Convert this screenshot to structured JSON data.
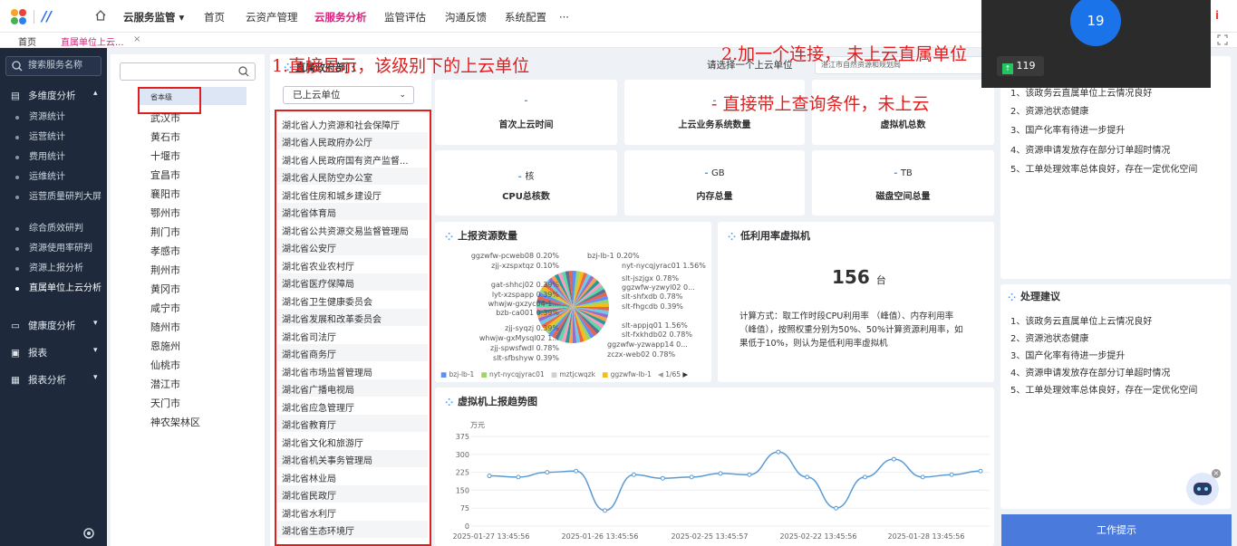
{
  "header": {
    "nav": [
      "云服务监管",
      "首页",
      "云资产管理",
      "云服务分析",
      "监管评估",
      "沟通反馈",
      "系统配置",
      "···"
    ],
    "active_nav": "云服务分析",
    "user_initial": "i"
  },
  "tabs": [
    "首页",
    "直属单位上云...",
    "×"
  ],
  "sidebar": {
    "search_placeholder": "搜索服务名称",
    "groups": [
      {
        "label": "多维度分析",
        "icon": "chart-icon"
      },
      {
        "label": "健康度分析",
        "icon": "monitor-icon"
      },
      {
        "label": "报表",
        "icon": "report-icon"
      },
      {
        "label": "报表分析",
        "icon": "report-analysis-icon"
      }
    ],
    "sub_items": [
      "资源统计",
      "运营统计",
      "费用统计",
      "运维统计",
      "运营质量研判大屏",
      "综合质效研判",
      "资源使用率研判",
      "资源上报分析",
      "直属单位上云分析"
    ]
  },
  "cities": [
    "省本级",
    "武汉市",
    "黄石市",
    "十堰市",
    "宜昌市",
    "襄阳市",
    "鄂州市",
    "荆门市",
    "孝感市",
    "荆州市",
    "黄冈市",
    "咸宁市",
    "随州市",
    "恩施州",
    "仙桃市",
    "潜江市",
    "天门市",
    "神农架林区"
  ],
  "departments": {
    "title": "直属政府部门",
    "filter": "已上云单位",
    "items": [
      "湖北省人力资源和社会保障厅",
      "湖北省人民政府办公厅",
      "湖北省人民政府国有资产监督...",
      "湖北省人民防空办公室",
      "湖北省住房和城乡建设厅",
      "湖北省体育局",
      "湖北省公共资源交易监督管理局",
      "湖北省公安厅",
      "湖北省农业农村厅",
      "湖北省医疗保障局",
      "湖北省卫生健康委员会",
      "湖北省发展和改革委员会",
      "湖北省司法厅",
      "湖北省商务厅",
      "湖北省市场监督管理局",
      "湖北省广播电视局",
      "湖北省应急管理厅",
      "湖北省教育厅",
      "湖北省文化和旅游厅",
      "湖北省机关事务管理局",
      "湖北省林业局",
      "湖北省民政厅",
      "湖北省水利厅",
      "湖北省生态环境厅"
    ]
  },
  "unit_select": {
    "label": "请选择一个上云单位",
    "value": "湛江市自然资源和规划局"
  },
  "annotations": {
    "a1": "1.直接显示，该级别下的上云单位",
    "a2": "2.加一个连接，  未上云直属单位",
    "a3": "- 直接带上查询条件，未上云"
  },
  "stats": [
    {
      "value": "-",
      "unit": "",
      "label": "首次上云时间"
    },
    {
      "value": "-",
      "unit": "",
      "label": "上云业务系统数量"
    },
    {
      "value": "-",
      "unit": "",
      "label": "虚拟机总数"
    },
    {
      "value": "-",
      "unit": "核",
      "label": "CPU总核数"
    },
    {
      "value": "-",
      "unit": "GB",
      "label": "内存总量"
    },
    {
      "value": "-",
      "unit": "TB",
      "label": "磁盘空间总量"
    }
  ],
  "pie": {
    "title": "上报资源数量",
    "labels_left": [
      "ggzwfw-pcweb08  0.20%",
      "zjj-xzspxtqz  0.10%",
      "gat-shhcj02  0.39%",
      "lyt-xzspapp  0.39%",
      "whwjw-gxzyc04  1...",
      "bzb-ca001  0.39%",
      "zjj-syqzj  0.39%",
      "whwjw-gxMysql02  1...",
      "zjj-spwsfwdl  0.78%",
      "slt-sfbshyw  0.39%"
    ],
    "labels_right": [
      "bzj-lb-1  0.20%",
      "nyt-nycqjyrac01  1.56%",
      "slt-jszjgx  0.78%",
      "ggzwfw-yzwyl02  0...",
      "slt-shfxdb  0.78%",
      "slt-fhgcdb  0.39%",
      "slt-appjq01  1.56%",
      "slt-fxkhdb02  0.78%",
      "ggzwfw-yzwapp14  0...",
      "zczx-web02  0.78%"
    ],
    "legend": [
      "bzj-lb-1",
      "nyt-nycqjyrac01",
      "mztjcwqzk",
      "ggzwfw-lb-1"
    ],
    "page": "1/65"
  },
  "low_util": {
    "title": "低利用率虚拟机",
    "count": "156",
    "unit": "台",
    "desc": "计算方式：取工作时段CPU利用率 （峰值）、内存利用率（峰值），按照权重分别为50%、50%计算资源利用率，如果低于10%，则认为是低利用率虚拟机"
  },
  "trend": {
    "title": "虚拟机上报趋势图",
    "unit": "万元",
    "x_labels": [
      "2025-01-27 13:45:56",
      "2025-01-26 13:45:56",
      "2025-02-25 13:45:57",
      "2025-02-22 13:45:56",
      "2025-01-28 13:45:56"
    ]
  },
  "chart_data": {
    "type": "line",
    "title": "虚拟机上报趋势图",
    "ylabel": "万元",
    "ylim": [
      0,
      375
    ],
    "yticks": [
      0,
      75,
      150,
      225,
      300,
      375
    ],
    "x": [
      "2025-01-27 13:45:56",
      "",
      "",
      "2025-01-26 13:45:56",
      "",
      "",
      "",
      "2025-02-25 13:45:57",
      "",
      "",
      "2025-02-22 13:45:56",
      "",
      "",
      "",
      "2025-01-28 13:45:56"
    ],
    "values": [
      210,
      205,
      225,
      230,
      65,
      215,
      200,
      205,
      220,
      215,
      310,
      205,
      75,
      205,
      280,
      205,
      215,
      230
    ],
    "grid": true
  },
  "advice": {
    "title": "处理建议",
    "items": [
      "1、该政务云直属单位上云情况良好",
      "2、资源池状态健康",
      "3、国产化率有待进一步提升",
      "4、资源申请发放存在部分订单超时情况",
      "5、工单处理效率总体良好，存在一定优化空间"
    ]
  },
  "video": {
    "badge": "19",
    "count": "119"
  },
  "work_button": "工作提示",
  "colors": {
    "accent": "#409eff",
    "active": "#d4237a",
    "annotation": "#e02020",
    "sidebar": "#1e2a3b"
  }
}
